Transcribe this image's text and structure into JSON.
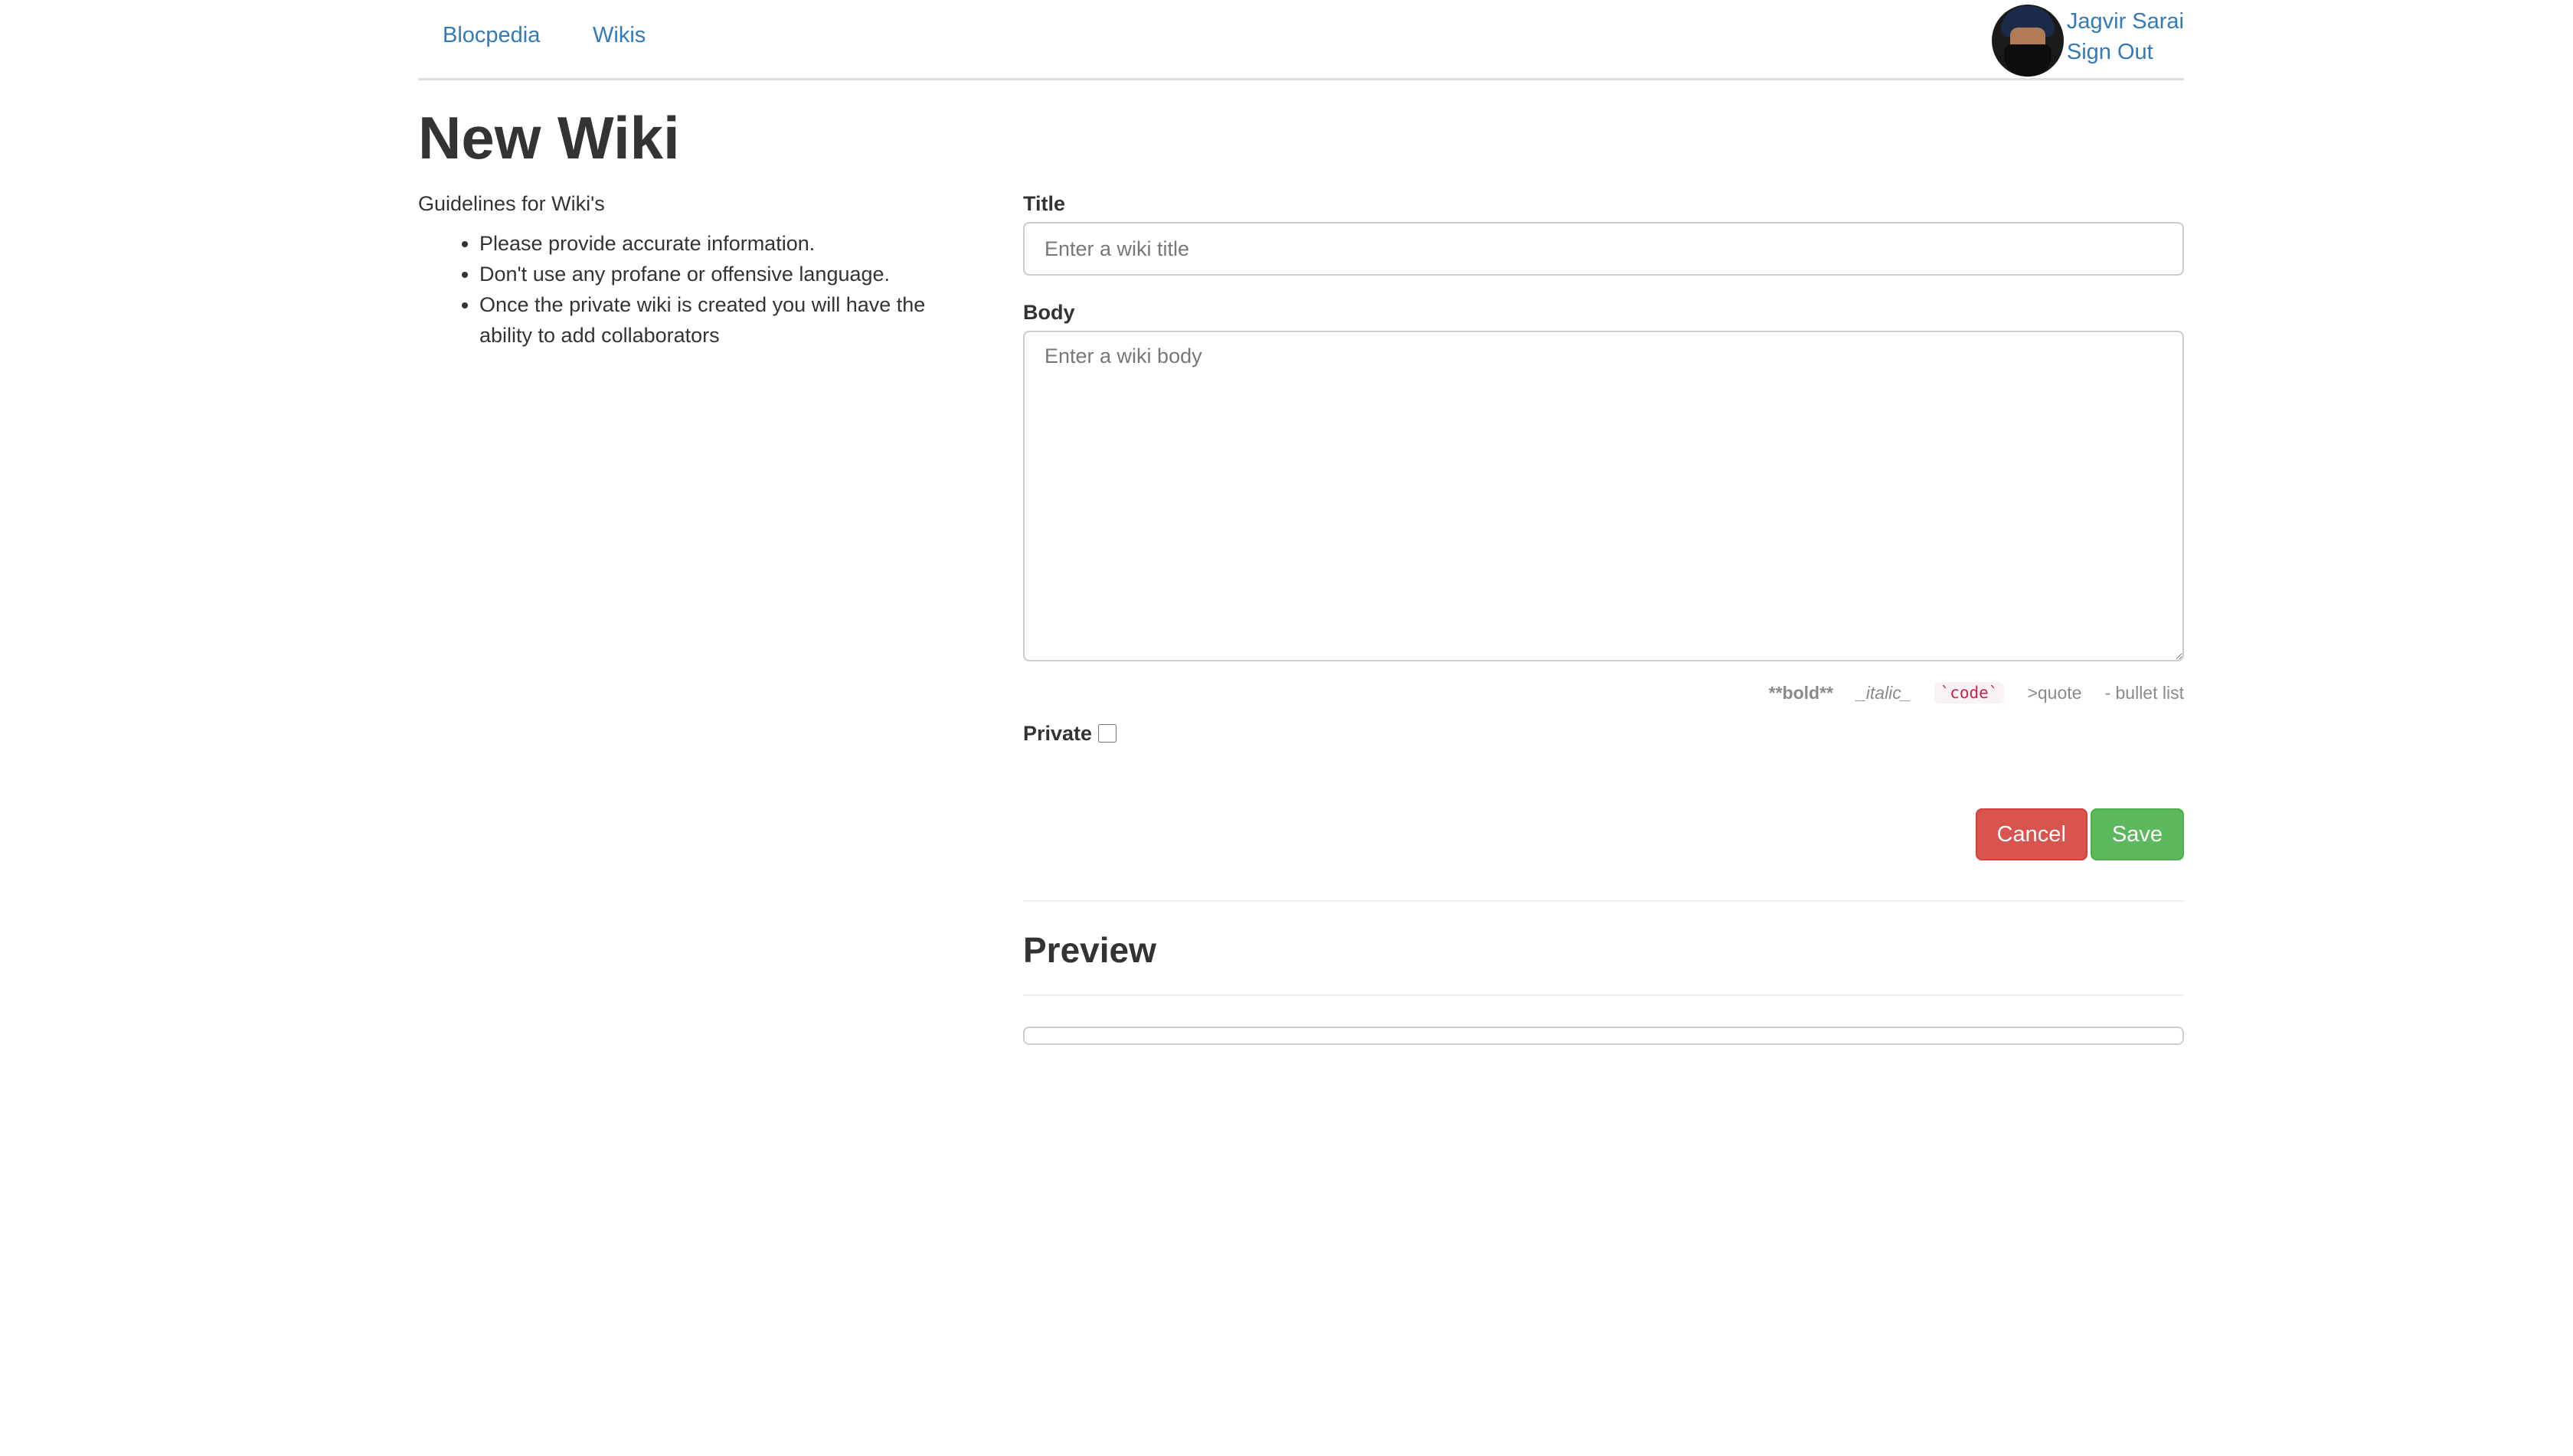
{
  "navbar": {
    "brand": "Blocpedia",
    "wikis": "Wikis",
    "user_name": "Jagvir Sarai",
    "sign_out": "Sign Out"
  },
  "page": {
    "title": "New Wiki"
  },
  "guidelines": {
    "heading": "Guidelines for Wiki's",
    "items": [
      "Please provide accurate information.",
      "Don't use any profane or offensive language.",
      "Once the private wiki is created you will have the ability to add collaborators"
    ]
  },
  "form": {
    "title_label": "Title",
    "title_placeholder": "Enter a wiki title",
    "title_value": "",
    "body_label": "Body",
    "body_placeholder": "Enter a wiki body",
    "body_value": "",
    "markdown_help": {
      "bold": "**bold**",
      "italic": "_italic_",
      "code": "`code`",
      "quote": ">quote",
      "list": "- bullet list"
    },
    "private_label": "Private",
    "private_checked": false,
    "cancel_label": "Cancel",
    "save_label": "Save"
  },
  "preview": {
    "heading": "Preview"
  },
  "colors": {
    "link": "#337ab7",
    "cancel": "#d9534f",
    "save": "#5cb85c"
  }
}
